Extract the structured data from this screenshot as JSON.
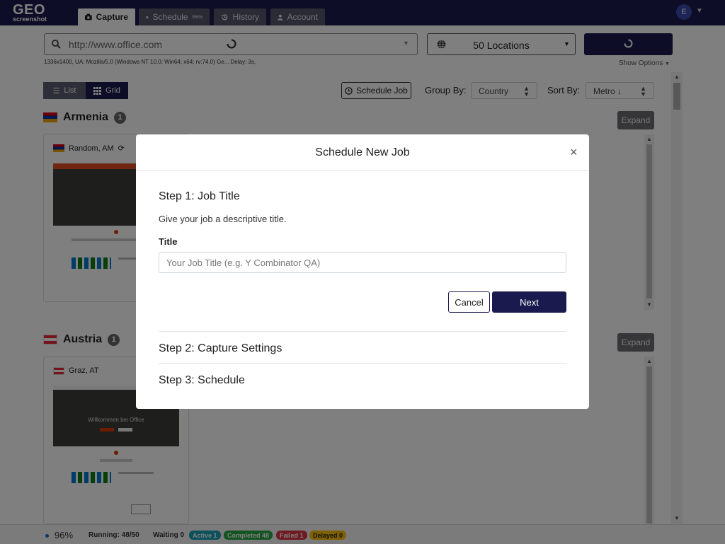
{
  "app": {
    "logo_main": "GEO",
    "logo_sub": "screenshot",
    "tabs": [
      {
        "label": "Capture",
        "icon": "camera-icon",
        "active": true
      },
      {
        "label": "Schedule",
        "badge": "Beta",
        "icon": "clock-icon",
        "active": false
      },
      {
        "label": "History",
        "icon": "history-icon",
        "active": false
      },
      {
        "label": "Account",
        "icon": "user-icon",
        "active": false
      }
    ],
    "avatar_initial": "E"
  },
  "capture": {
    "url_value": "http://www.office.com",
    "locations_label": "50 Locations",
    "meta_line": "1336x1400, UA: Mozilla/5.0 (Windows NT 10.0; Win64; x64; rv:74.0) Ge...  Delay: 3s,",
    "show_options": "Show Options"
  },
  "toolbar": {
    "view_list": "List",
    "view_grid": "Grid",
    "schedule_job": "Schedule Job",
    "group_by_label": "Group By:",
    "group_by_value": "Country",
    "sort_by_label": "Sort By:",
    "sort_by_value": "Metro ↓"
  },
  "groups": [
    {
      "country": "Armenia",
      "count": "1",
      "expand": "Expand",
      "card_title": "Random, AM"
    },
    {
      "country": "Austria",
      "count": "1",
      "expand": "Expand",
      "card_title": "Graz, AT",
      "thumb_hero_text": "Willkommen bei Office"
    }
  ],
  "status": {
    "percent": "96%",
    "running": "Running: 48/50",
    "waiting": "Waiting 0",
    "active": "Active 1",
    "completed": "Completed 48",
    "failed": "Failed 1",
    "delayed": "Delayed 0",
    "colors": {
      "active": "#17a2b8",
      "completed": "#28a745",
      "failed": "#dc3545",
      "delayed": "#ffc107"
    }
  },
  "modal": {
    "title": "Schedule New Job",
    "close": "×",
    "step1_heading": "Step 1: Job Title",
    "step1_desc": "Give your job a descriptive title.",
    "title_label": "Title",
    "title_placeholder": "Your Job Title (e.g. Y Combinator QA)",
    "cancel": "Cancel",
    "next": "Next",
    "step2_heading": "Step 2: Capture Settings",
    "step3_heading": "Step 3: Schedule"
  },
  "colors": {
    "brand_navy": "#1a1a4e"
  }
}
